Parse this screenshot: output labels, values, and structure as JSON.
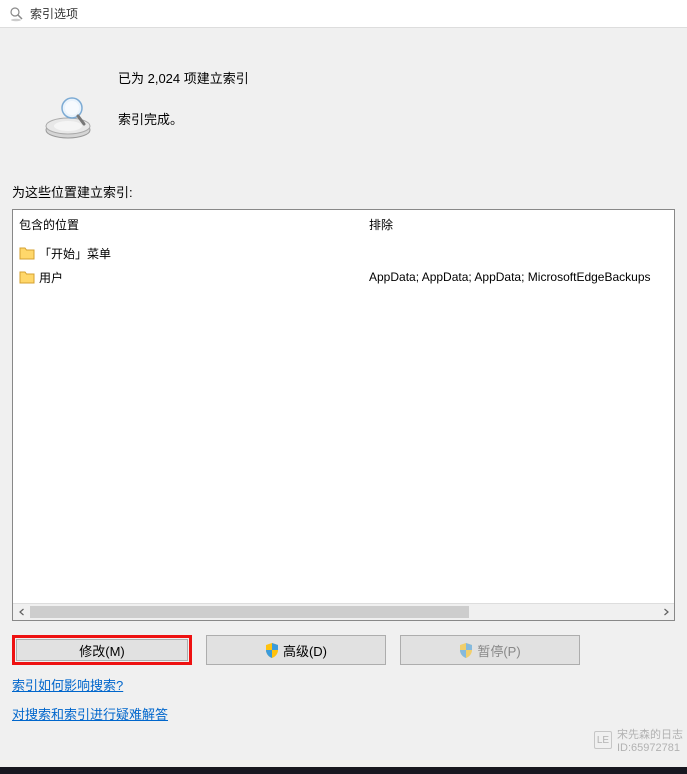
{
  "titlebar": {
    "title": "索引选项"
  },
  "header": {
    "line1": "已为 2,024 项建立索引",
    "line2": "索引完成。"
  },
  "section_label": "为这些位置建立索引:",
  "columns": {
    "left": "包含的位置",
    "right": "排除"
  },
  "rows": [
    {
      "name": "「开始」菜单",
      "exclude": ""
    },
    {
      "name": "用户",
      "exclude": "AppData; AppData; AppData; MicrosoftEdgeBackups"
    }
  ],
  "buttons": {
    "modify": "修改(M)",
    "advanced": "高级(D)",
    "pause": "暂停(P)"
  },
  "links": {
    "how": "索引如何影响搜索?",
    "troubleshoot": "对搜索和索引进行疑难解答"
  },
  "watermark": {
    "name": "宋先森的日志",
    "id": "ID:65972781"
  }
}
